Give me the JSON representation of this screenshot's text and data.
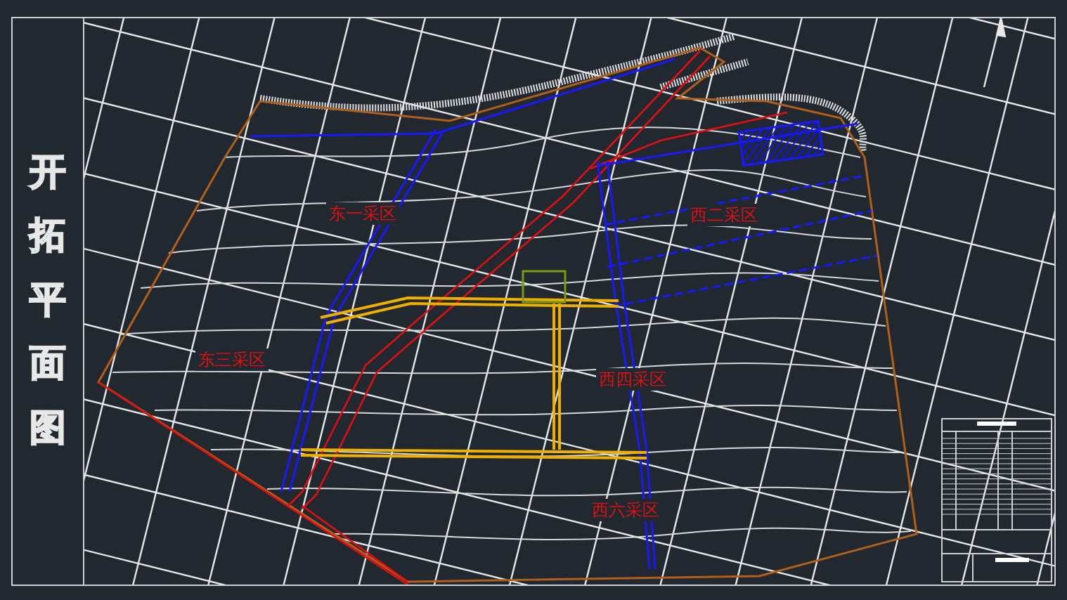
{
  "title": "开拓平面图",
  "zones": [
    {
      "name": "东一采区"
    },
    {
      "name": "东三采区"
    },
    {
      "name": "西二采区"
    },
    {
      "name": "西四采区"
    },
    {
      "name": "西六采区"
    }
  ]
}
